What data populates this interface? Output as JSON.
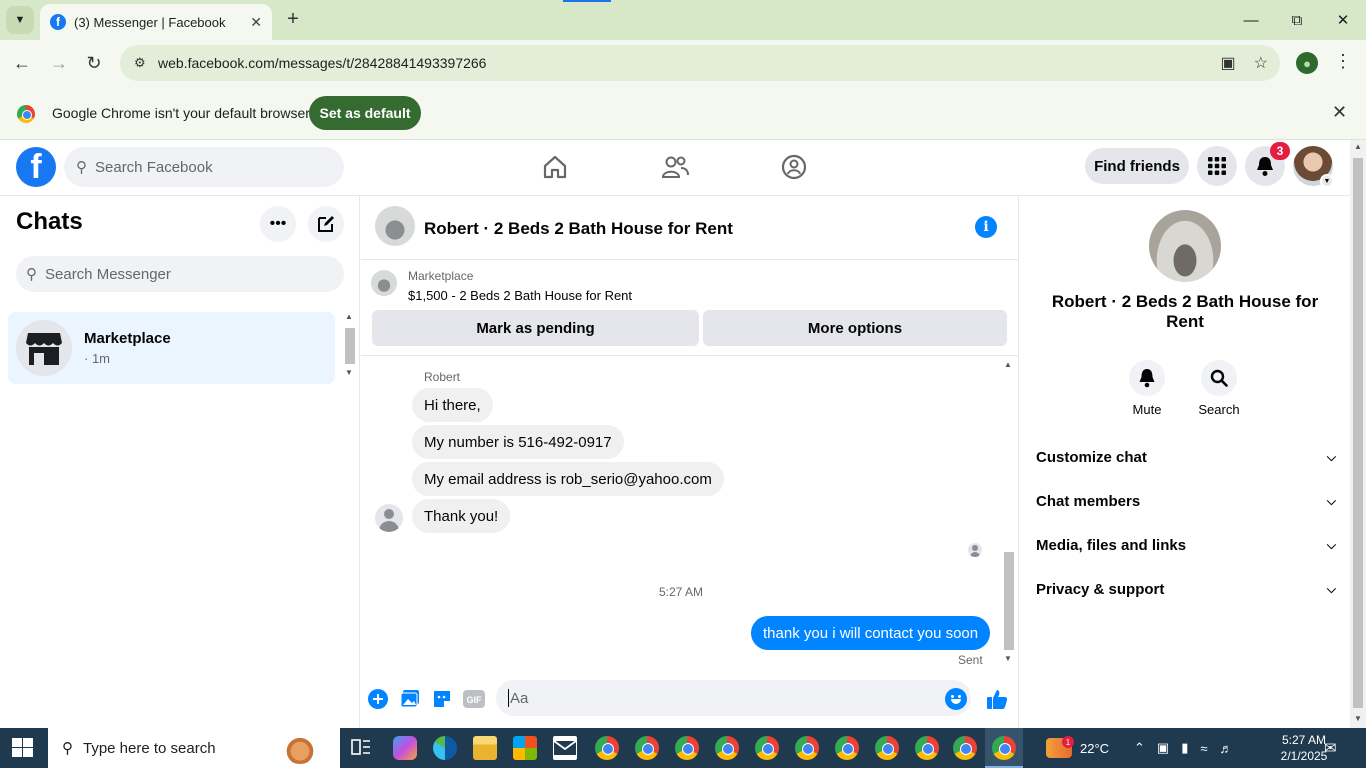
{
  "browser": {
    "tab_title": "(3) Messenger | Facebook",
    "url": "web.facebook.com/messages/t/28428841493397266",
    "infobar_text": "Google Chrome isn't your default browser",
    "set_default_label": "Set as default"
  },
  "fb_header": {
    "search_placeholder": "Search Facebook",
    "find_friends_label": "Find friends",
    "notification_count": "3"
  },
  "sidebar": {
    "title": "Chats",
    "search_placeholder": "Search Messenger",
    "chats": [
      {
        "name": "Marketplace",
        "time": "· 1m"
      }
    ]
  },
  "conversation": {
    "title": "Robert · 2 Beds 2 Bath House for Rent",
    "marketplace_label": "Marketplace",
    "listing": "$1,500 - 2 Beds 2 Bath House for Rent",
    "mark_pending_label": "Mark as pending",
    "more_options_label": "More options",
    "sender_name": "Robert",
    "incoming": [
      "Hi there,",
      "My number is 516-492-0917",
      "My email address is rob_serio@yahoo.com",
      "Thank you!"
    ],
    "time_separator": "5:27 AM",
    "outgoing": "thank you i will contact you soon",
    "sent_status": "Sent",
    "composer_placeholder": "Aa"
  },
  "info_panel": {
    "name": "Robert · 2 Beds 2 Bath House for Rent",
    "actions": [
      "Mute",
      "Search"
    ],
    "sections": [
      "Customize chat",
      "Chat members",
      "Media, files and links",
      "Privacy & support"
    ]
  },
  "taskbar": {
    "search_placeholder": "Type here to search",
    "weather": "22°C",
    "time": "5:27 AM",
    "date": "2/1/2025",
    "weather_badge": "1"
  },
  "colors": {
    "fb_blue": "#1877f2",
    "messenger_blue": "#0084ff",
    "chrome_frame": "#d7e8c9",
    "set_default_green": "#356a30",
    "notification_red": "#e41e3f"
  }
}
